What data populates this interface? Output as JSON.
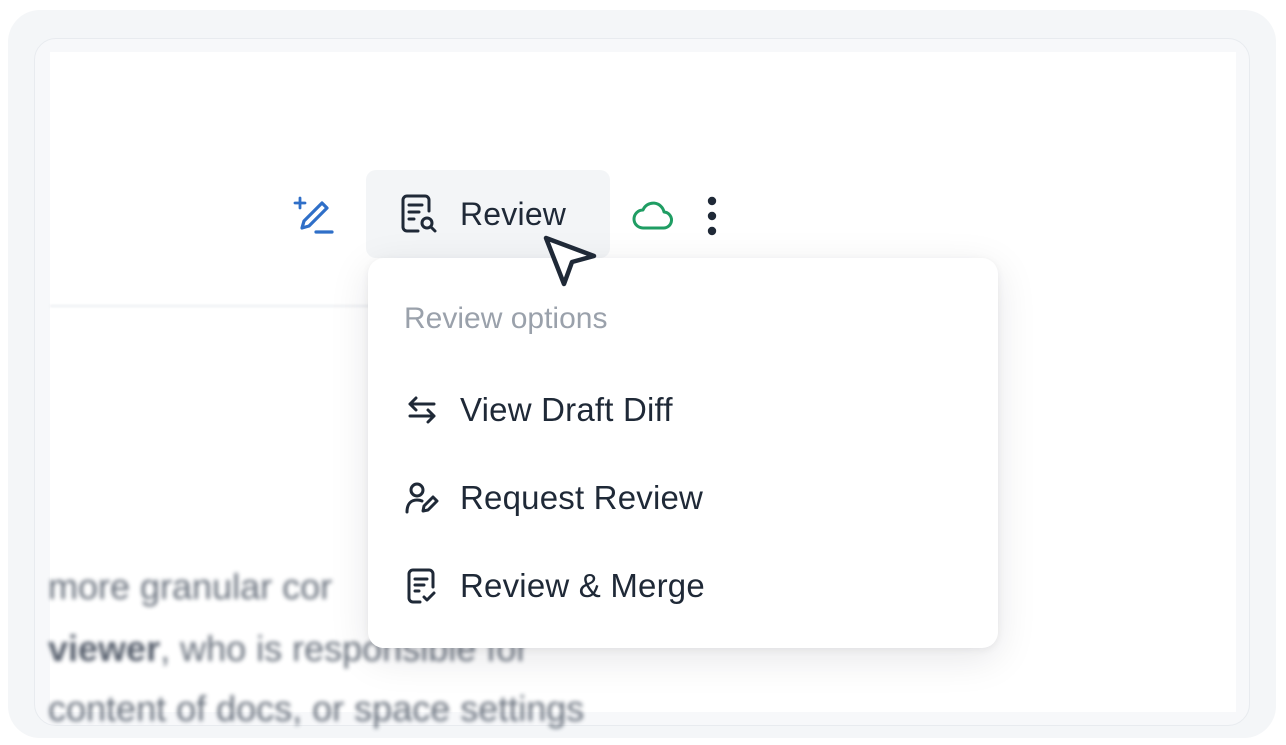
{
  "toolbar": {
    "ai_edit_icon": "pencil-sparkle-icon",
    "review_label": "Review",
    "review_icon": "document-search-icon",
    "cloud_icon": "cloud-icon",
    "more_icon": "vertical-ellipsis-icon"
  },
  "menu": {
    "heading": "Review options",
    "items": [
      {
        "label": "View Draft Diff",
        "icon": "swap-arrows-icon"
      },
      {
        "label": "Request Review",
        "icon": "user-pen-icon"
      },
      {
        "label": "Review & Merge",
        "icon": "document-check-icon"
      }
    ]
  },
  "background_text": {
    "line1_prefix": "more gr",
    "line1_visible": "anular cor",
    "line2_bold": "viewer",
    "line2_rest": ", who is responsible for",
    "line3": "content of docs, or space settings"
  },
  "colors": {
    "accent_blue": "#2f6fc8",
    "cloud_green": "#1f9d63",
    "text_dark": "#1f2937",
    "text_muted": "#9aa1ab"
  }
}
